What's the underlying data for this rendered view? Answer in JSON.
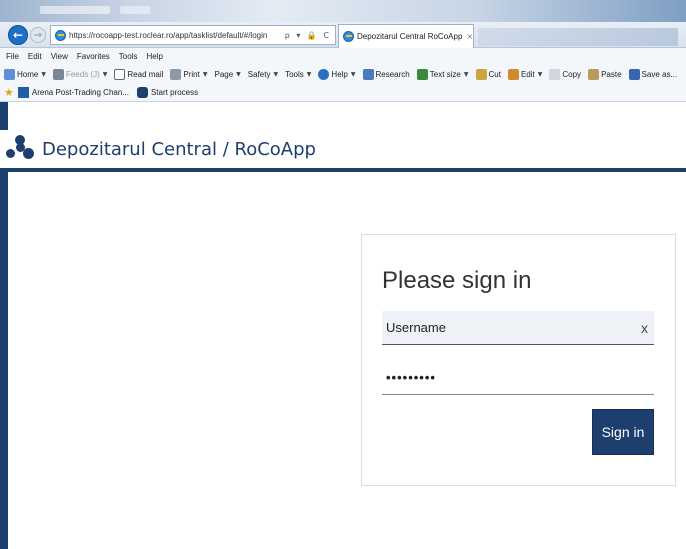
{
  "browser": {
    "address_url": "https://rocoapp-test.roclear.ro/app/tasklist/default/#/login",
    "address_icons": "ρ ▾ 🔒 C",
    "tab_title": "Depozitarul Central RoCoApp",
    "tab_close": "×",
    "menu": [
      "File",
      "Edit",
      "View",
      "Favorites",
      "Tools",
      "Help"
    ],
    "commands": {
      "home": "Home",
      "feeds": "Feeds (J)",
      "read_mail": "Read mail",
      "print": "Print",
      "page": "Page",
      "safety": "Safety",
      "tools": "Tools",
      "help": "Help",
      "research": "Research",
      "text_size": "Text size",
      "cut": "Cut",
      "edit": "Edit",
      "copy": "Copy",
      "paste": "Paste",
      "save_as": "Save as..."
    },
    "favorites": {
      "arena": "Arena Post-Trading Chan...",
      "start_process": "Start process"
    }
  },
  "app": {
    "title": "Depozitarul Central / RoCoApp",
    "brand_color": "#1d3f6e"
  },
  "login": {
    "heading": "Please sign in",
    "username_value": "Username",
    "clear_label": "x",
    "password_value": "•••••••••",
    "submit_label": "Sign in"
  }
}
